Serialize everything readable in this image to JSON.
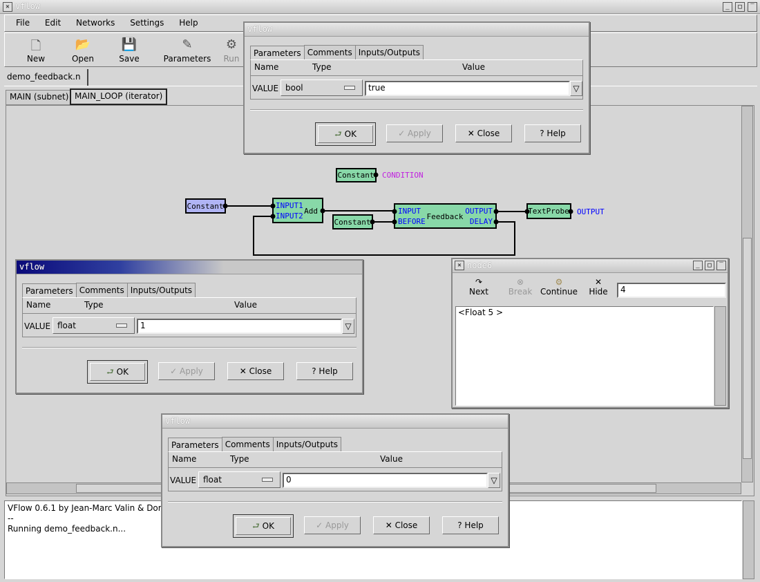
{
  "main_window": {
    "title": "vflow",
    "menu": [
      "File",
      "Edit",
      "Networks",
      "Settings",
      "Help"
    ],
    "toolbar": [
      {
        "label": "New",
        "icon": "new-file-icon"
      },
      {
        "label": "Open",
        "icon": "folder-icon"
      },
      {
        "label": "Save",
        "icon": "floppy-icon"
      },
      {
        "label": "Parameters",
        "icon": "parameters-icon"
      },
      {
        "label": "Run",
        "icon": "gears-icon"
      }
    ],
    "file_tab": "demo_feedback.n",
    "subnet_tabs": [
      "MAIN (subnet)",
      "MAIN_LOOP (iterator)"
    ],
    "log": [
      "VFlow 0.6.1 by Jean-Marc Valin & Dom",
      "--",
      "Running demo_feedback.n..."
    ]
  },
  "diagram": {
    "nodes": [
      {
        "id": "const1",
        "label": "Constant",
        "color": "#b0b4f4"
      },
      {
        "id": "add",
        "label": "Add",
        "inputs": [
          "INPUT1",
          "INPUT2"
        ],
        "color": "#88d8a8"
      },
      {
        "id": "const2",
        "label": "Constant",
        "color": "#88d8a8",
        "output_label": "CONDITION"
      },
      {
        "id": "const3",
        "label": "Constant",
        "color": "#88d8a8"
      },
      {
        "id": "feedback",
        "label": "Feedback",
        "inputs": [
          "INPUT",
          "BEFORE"
        ],
        "outputs": [
          "OUTPUT",
          "DELAY"
        ],
        "color": "#88d8a8"
      },
      {
        "id": "probe",
        "label": "TextProbe",
        "color": "#88d8a8",
        "output_label": "OUTPUT"
      }
    ],
    "condition_color": "#c020e0",
    "port_color": "#0000ff"
  },
  "dialogs": [
    {
      "title": "vflow",
      "tabs": [
        "Parameters",
        "Comments",
        "Inputs/Outputs"
      ],
      "headers": [
        "Name",
        "Type",
        "Value"
      ],
      "param_name": "VALUE",
      "type": "bool",
      "value": "true",
      "buttons": [
        "OK",
        "Apply",
        "Close",
        "Help"
      ]
    },
    {
      "title": "vflow",
      "tabs": [
        "Parameters",
        "Comments",
        "Inputs/Outputs"
      ],
      "headers": [
        "Name",
        "Type",
        "Value"
      ],
      "param_name": "VALUE",
      "type": "float",
      "value": "1",
      "buttons": [
        "OK",
        "Apply",
        "Close",
        "Help"
      ]
    },
    {
      "title": "vflow",
      "tabs": [
        "Parameters",
        "Comments",
        "Inputs/Outputs"
      ],
      "headers": [
        "Name",
        "Type",
        "Value"
      ],
      "param_name": "VALUE",
      "type": "float",
      "value": "0",
      "buttons": [
        "OK",
        "Apply",
        "Close",
        "Help"
      ]
    }
  ],
  "probe_window": {
    "title": "node6",
    "buttons": [
      "Next",
      "Break",
      "Continue",
      "Hide"
    ],
    "count": "4",
    "output": "<Float 5 >"
  }
}
